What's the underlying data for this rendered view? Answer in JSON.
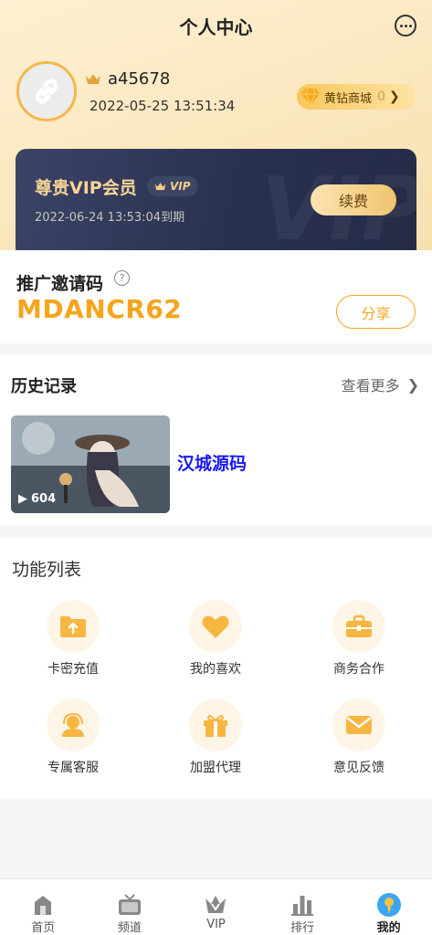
{
  "header": {
    "title": "个人中心"
  },
  "profile": {
    "username": "a45678",
    "reg_time": "2022-05-25 13:51:34",
    "diamond_mall_label": "黄钻商城",
    "diamond_count": "0"
  },
  "vip": {
    "title": "尊贵VIP会员",
    "badge": "VIP",
    "expire": "2022-06-24 13:53:04到期",
    "renew_label": "续费",
    "watermark": "VIP"
  },
  "invite": {
    "label": "推广邀请码",
    "help": "?",
    "code": "MDANCR62",
    "share_label": "分享"
  },
  "history": {
    "title": "历史记录",
    "more_label": "查看更多",
    "items": [
      {
        "title": "汉城源码",
        "views": "604"
      }
    ]
  },
  "functions": {
    "title": "功能列表",
    "items": [
      {
        "label": "卡密充值",
        "icon": "folder-upload-icon"
      },
      {
        "label": "我的喜欢",
        "icon": "heart-icon"
      },
      {
        "label": "商务合作",
        "icon": "briefcase-icon"
      },
      {
        "label": "专属客服",
        "icon": "headset-icon"
      },
      {
        "label": "加盟代理",
        "icon": "gift-icon"
      },
      {
        "label": "意见反馈",
        "icon": "mail-icon"
      }
    ]
  },
  "tabbar": {
    "items": [
      {
        "label": "首页",
        "icon": "home-icon"
      },
      {
        "label": "频道",
        "icon": "tv-icon"
      },
      {
        "label": "VIP",
        "icon": "vip-icon"
      },
      {
        "label": "排行",
        "icon": "chart-icon"
      },
      {
        "label": "我的",
        "icon": "profile-icon",
        "active": true
      }
    ]
  },
  "colors": {
    "accent": "#f5a51c",
    "vip_card": "#2a3150",
    "video_title": "#1a1aee"
  }
}
